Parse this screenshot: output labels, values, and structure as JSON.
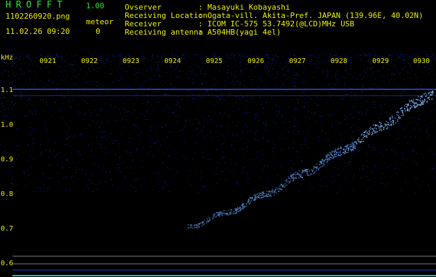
{
  "header": {
    "app_title": "HROFFT",
    "app_version": "1.00",
    "filename": "1102260920.png",
    "datetime": "11.02.26 09:20",
    "meteor_label": "meteor",
    "meteor_count": "0",
    "info": [
      {
        "label": "Ovserver",
        "value": ": Masayuki Kobayashi"
      },
      {
        "label": "Receiving Location",
        "value": ": Ogata-vill. Akita-Pref. JAPAN (139.96E, 40.02N)"
      },
      {
        "label": "Receiver",
        "value": ": ICOM IC-575 53.7492(@LCD)MHz USB"
      },
      {
        "label": "Receiving antenna",
        "value": ": A504HB(yagi 4el)"
      }
    ]
  },
  "spectrogram": {
    "y_unit": "kHz",
    "x_ticks": [
      "0921",
      "0922",
      "0923",
      "0924",
      "0925",
      "0926",
      "0927",
      "0928",
      "0929",
      "0930"
    ],
    "y_ticks": [
      "1.1",
      "1.0",
      "0.9",
      "0.8",
      "0.7",
      "0.6"
    ],
    "colors": {
      "text": "#f0f000",
      "noise": "#1a2fd6",
      "trace": "#6aa8ff",
      "hline": "#3a5aff",
      "grey_line": "#9a9a9a",
      "baseline": "#00e0e0"
    }
  }
}
